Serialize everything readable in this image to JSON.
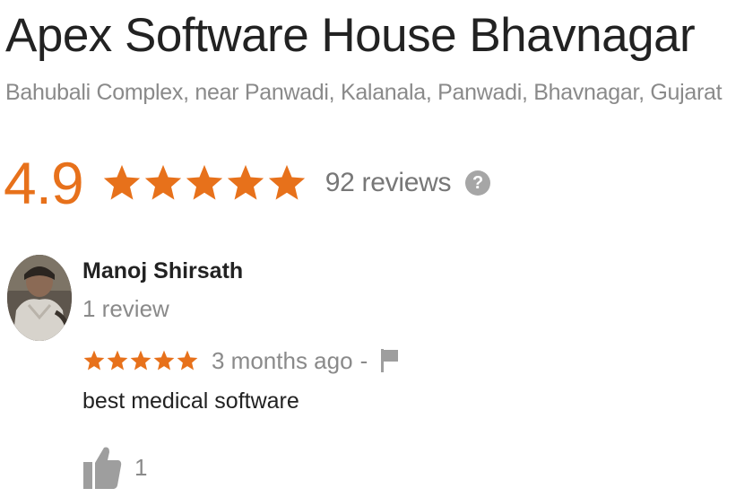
{
  "business": {
    "name": "Apex Software House Bhavnagar",
    "address": "Bahubali Complex, near Panwadi, Kalanala, Panwadi, Bhavnagar, Gujarat"
  },
  "rating": {
    "score": "4.9",
    "stars_filled": 5,
    "stars_total": 5,
    "reviews_label": "92 reviews",
    "help_glyph": "?"
  },
  "review": {
    "reviewer_name": "Manoj Shirsath",
    "reviewer_meta": "1 review",
    "stars_filled": 5,
    "stars_total": 5,
    "date": "3 months ago",
    "separator": "-",
    "text": "best medical software",
    "like_count": "1"
  },
  "colors": {
    "accent": "#e7711b",
    "muted": "#8a8a8a",
    "icon_gray": "#a6a6a6"
  },
  "icons": {
    "help": "help-icon",
    "flag": "flag-icon",
    "like": "thumbs-up-icon",
    "star": "star-icon",
    "avatar": "avatar"
  }
}
